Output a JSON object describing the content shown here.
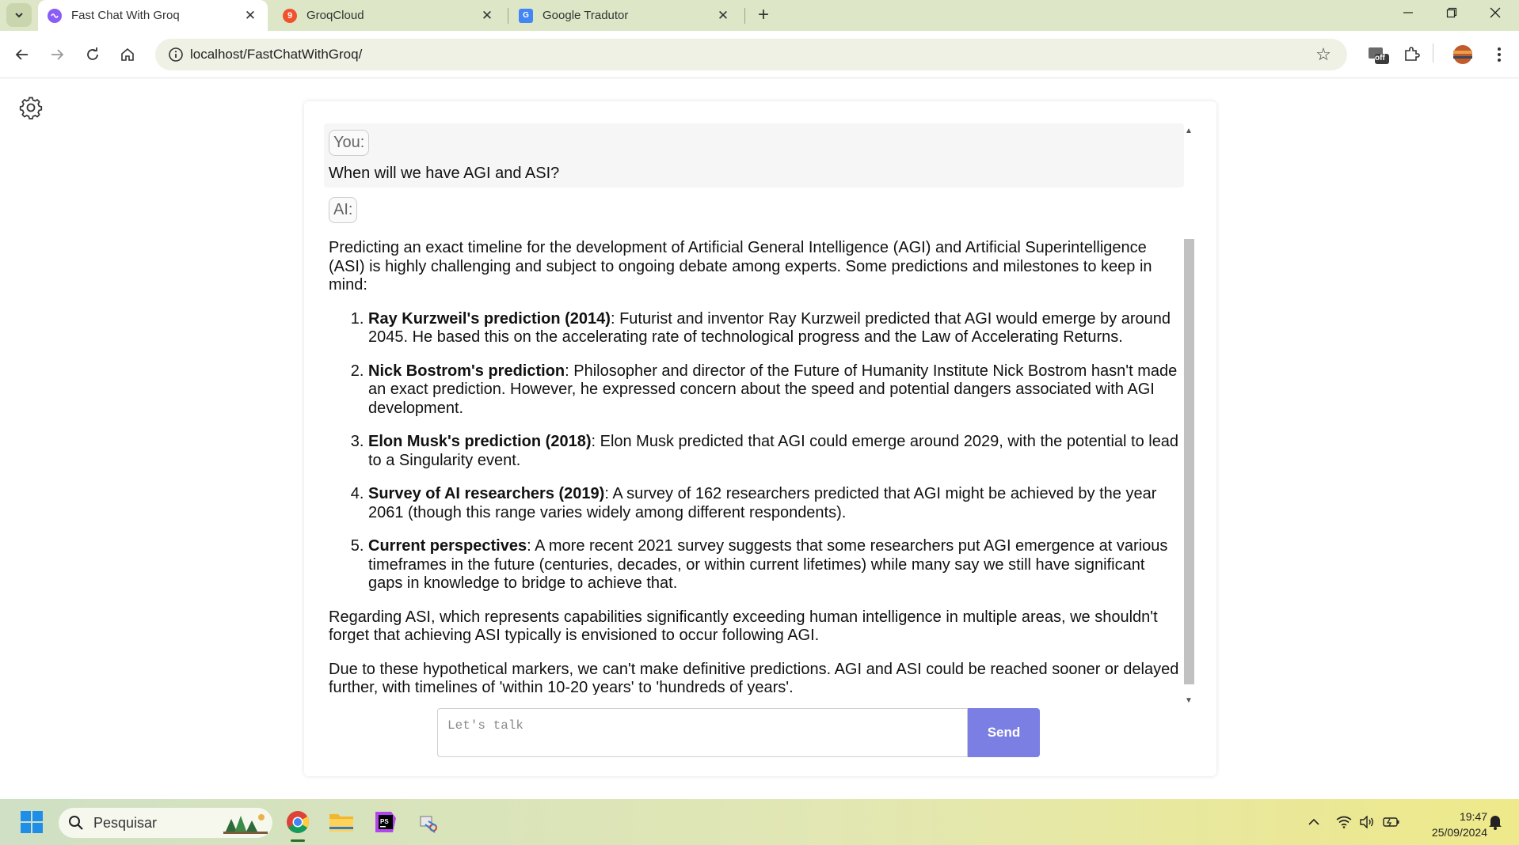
{
  "browser": {
    "tabs": [
      {
        "title": "Fast Chat With Groq",
        "active": true
      },
      {
        "title": "GroqCloud",
        "active": false,
        "favicon_text": "9"
      },
      {
        "title": "Google Tradutor",
        "active": false
      }
    ],
    "url": "localhost/FastChatWithGroq/",
    "extension_badge": "off",
    "colors": {
      "tabbar": "#dde7c7",
      "omnibox": "#eef1e4"
    }
  },
  "chat": {
    "user_label": "You:",
    "user_message": "When will we have AGI and ASI?",
    "ai_label": "AI:",
    "ai_intro": "Predicting an exact timeline for the development of Artificial General Intelligence (AGI) and Artificial Superintelligence (ASI) is highly challenging and subject to ongoing debate among experts. Some predictions and milestones to keep in mind:",
    "ai_list": [
      {
        "title": "Ray Kurzweil's prediction (2014)",
        "text": ": Futurist and inventor Ray Kurzweil predicted that AGI would emerge by around 2045. He based this on the accelerating rate of technological progress and the Law of Accelerating Returns."
      },
      {
        "title": "Nick Bostrom's prediction",
        "text": ": Philosopher and director of the Future of Humanity Institute Nick Bostrom hasn't made an exact prediction. However, he expressed concern about the speed and potential dangers associated with AGI development."
      },
      {
        "title": "Elon Musk's prediction (2018)",
        "text": ": Elon Musk predicted that AGI could emerge around 2029, with the potential to lead to a Singularity event."
      },
      {
        "title": "Survey of AI researchers (2019)",
        "text": ": A survey of 162 researchers predicted that AGI might be achieved by the year 2061 (though this range varies widely among different respondents)."
      },
      {
        "title": "Current perspectives",
        "text": ": A more recent 2021 survey suggests that some researchers put AGI emergence at various timeframes in the future (centuries, decades, or within current lifetimes) while many say we still have significant gaps in knowledge to bridge to achieve that."
      }
    ],
    "ai_para2": "Regarding ASI, which represents capabilities significantly exceeding human intelligence in multiple areas, we shouldn't forget that achieving ASI typically is envisioned to occur following AGI.",
    "ai_para3": "Due to these hypothetical markers, we can't make definitive predictions. AGI and ASI could be reached sooner or delayed further, with timelines of 'within 10-20 years' to 'hundreds of years'.",
    "input_placeholder": "Let's talk",
    "input_value": "",
    "send_label": "Send",
    "colors": {
      "send_button": "#7b7fe3",
      "user_bubble": "#f6f6f6"
    }
  },
  "taskbar": {
    "search_placeholder": "Pesquisar",
    "time": "19:47",
    "date": "25/09/2024"
  }
}
